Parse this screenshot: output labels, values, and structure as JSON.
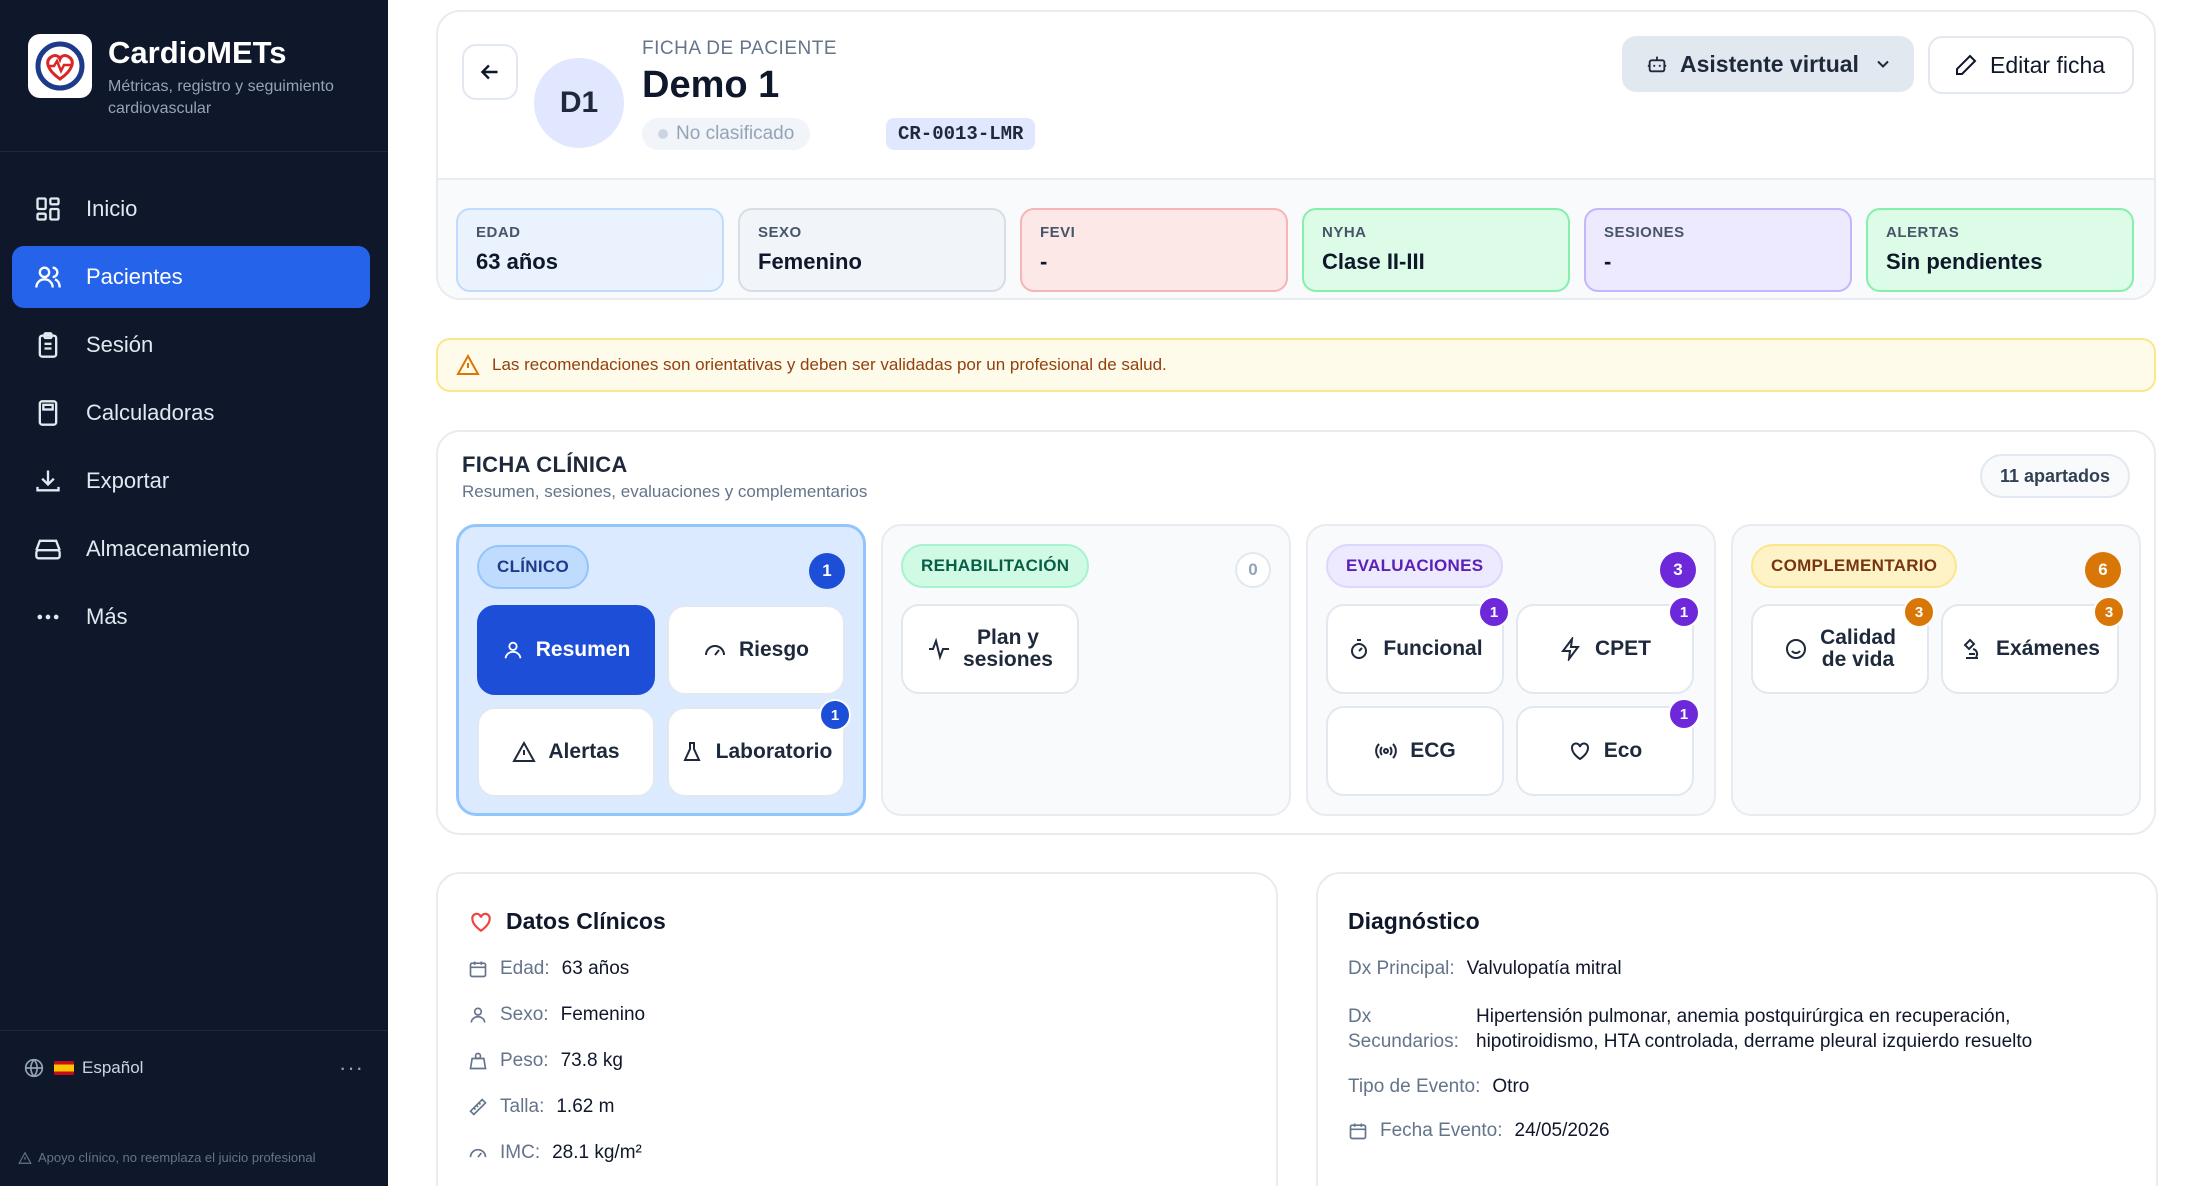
{
  "sidebar": {
    "brand_title": "CardioMETs",
    "brand_subtitle": "Métricas, registro y seguimiento cardiovascular",
    "nav": [
      {
        "label": "Inicio",
        "icon": "grid-icon",
        "active": false
      },
      {
        "label": "Pacientes",
        "icon": "users-icon",
        "active": true
      },
      {
        "label": "Sesión",
        "icon": "clipboard-icon",
        "active": false
      },
      {
        "label": "Calculadoras",
        "icon": "calculator-icon",
        "active": false
      },
      {
        "label": "Exportar",
        "icon": "download-icon",
        "active": false
      },
      {
        "label": "Almacenamiento",
        "icon": "storage-icon",
        "active": false
      },
      {
        "label": "Más",
        "icon": "more-icon",
        "active": false
      }
    ],
    "language": "Español",
    "disclaimer": "Apoyo clínico, no reemplaza el juicio profesional"
  },
  "header": {
    "ficha_label": "FICHA DE PACIENTE",
    "avatar_initials": "D1",
    "patient_name": "Demo 1",
    "status_chip": "No clasificado",
    "patient_id": "CR-0013-LMR",
    "assistant_button": "Asistente virtual",
    "edit_button": "Editar ficha"
  },
  "stats": [
    {
      "label": "EDAD",
      "value": "63 años",
      "color": "#eaf2fe"
    },
    {
      "label": "SEXO",
      "value": "Femenino",
      "color": "#f1f5f9"
    },
    {
      "label": "FEVI",
      "value": "-",
      "color": "#fde8e8"
    },
    {
      "label": "NYHA",
      "value": "Clase II-III",
      "color": "#dcfce7"
    },
    {
      "label": "SESIONES",
      "value": "-",
      "color": "#ede9fe"
    },
    {
      "label": "ALERTAS",
      "value": "Sin pendientes",
      "color": "#dcfce7"
    }
  ],
  "warning": "Las recomendaciones son orientativas y deben ser validadas por un profesional de salud.",
  "ficha": {
    "title": "FICHA CLÍNICA",
    "subtitle": "Resumen, sesiones, evaluaciones y complementarios",
    "count_badge": "11 apartados",
    "groups": [
      {
        "tag": "CLÍNICO",
        "count": "1",
        "tiles": [
          {
            "label": "Resumen",
            "icon": "user-icon",
            "badge": null,
            "selected": true
          },
          {
            "label": "Riesgo",
            "icon": "gauge-icon",
            "badge": null,
            "selected": false
          },
          {
            "label": "Alertas",
            "icon": "alert-icon",
            "badge": null,
            "selected": false
          },
          {
            "label": "Laboratorio",
            "icon": "flask-icon",
            "badge": "1",
            "selected": false
          }
        ]
      },
      {
        "tag": "REHABILITACIÓN",
        "count": "0",
        "tiles": [
          {
            "label_line1": "Plan y",
            "label_line2": "sesiones",
            "icon": "activity-icon",
            "badge": null
          }
        ]
      },
      {
        "tag": "EVALUACIONES",
        "count": "3",
        "tiles": [
          {
            "label": "Funcional",
            "icon": "timer-icon",
            "badge": "1"
          },
          {
            "label": "CPET",
            "icon": "zap-icon",
            "badge": "1"
          },
          {
            "label": "ECG",
            "icon": "radio-icon",
            "badge": null
          },
          {
            "label": "Eco",
            "icon": "heart-icon",
            "badge": "1"
          }
        ]
      },
      {
        "tag": "COMPLEMENTARIO",
        "count": "6",
        "tiles": [
          {
            "label_line1": "Calidad",
            "label_line2": "de vida",
            "icon": "smile-icon",
            "badge": "3"
          },
          {
            "label": "Exámenes",
            "icon": "microscope-icon",
            "badge": "3"
          }
        ]
      }
    ]
  },
  "datos": {
    "title": "Datos Clínicos",
    "rows": [
      {
        "key": "Edad:",
        "value": "63 años",
        "icon": "calendar-icon"
      },
      {
        "key": "Sexo:",
        "value": "Femenino",
        "icon": "user-icon"
      },
      {
        "key": "Peso:",
        "value": "73.8 kg",
        "icon": "weight-icon"
      },
      {
        "key": "Talla:",
        "value": "1.62 m",
        "icon": "ruler-icon"
      },
      {
        "key": "IMC:",
        "value": "28.1 kg/m²",
        "icon": "gauge-icon"
      }
    ]
  },
  "diagnostico": {
    "title": "Diagnóstico",
    "dx_principal_key": "Dx Principal:",
    "dx_principal_value": "Valvulopatía mitral",
    "dx_secundarios_key": "Dx Secundarios:",
    "dx_secundarios_value": "Hipertensión pulmonar, anemia postquirúrgica en recuperación, hipotiroidismo, HTA controlada, derrame pleural izquierdo resuelto",
    "tipo_evento_key": "Tipo de Evento:",
    "tipo_evento_value": "Otro",
    "fecha_evento_key": "Fecha Evento:",
    "fecha_evento_value": "24/05/2026"
  }
}
